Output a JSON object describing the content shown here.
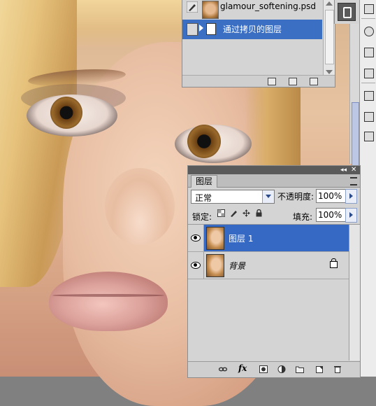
{
  "history_panel": {
    "source_document": "glamour_softening.psd",
    "active_step": "通过拷贝的图层"
  },
  "layers_panel": {
    "tab_label": "图层",
    "blend_mode": "正常",
    "opacity_label": "不透明度:",
    "opacity_value": "100%",
    "lock_label": "锁定:",
    "fill_label": "填充:",
    "fill_value": "100%",
    "layers": [
      {
        "name": "图层 1",
        "selected": true,
        "visible": true,
        "locked": false
      },
      {
        "name": "背景",
        "selected": false,
        "visible": true,
        "locked": true
      }
    ],
    "footer_fx_label": "fx"
  },
  "colors": {
    "selection_blue": "#3569c4",
    "panel_gray": "#d4d4d4"
  }
}
